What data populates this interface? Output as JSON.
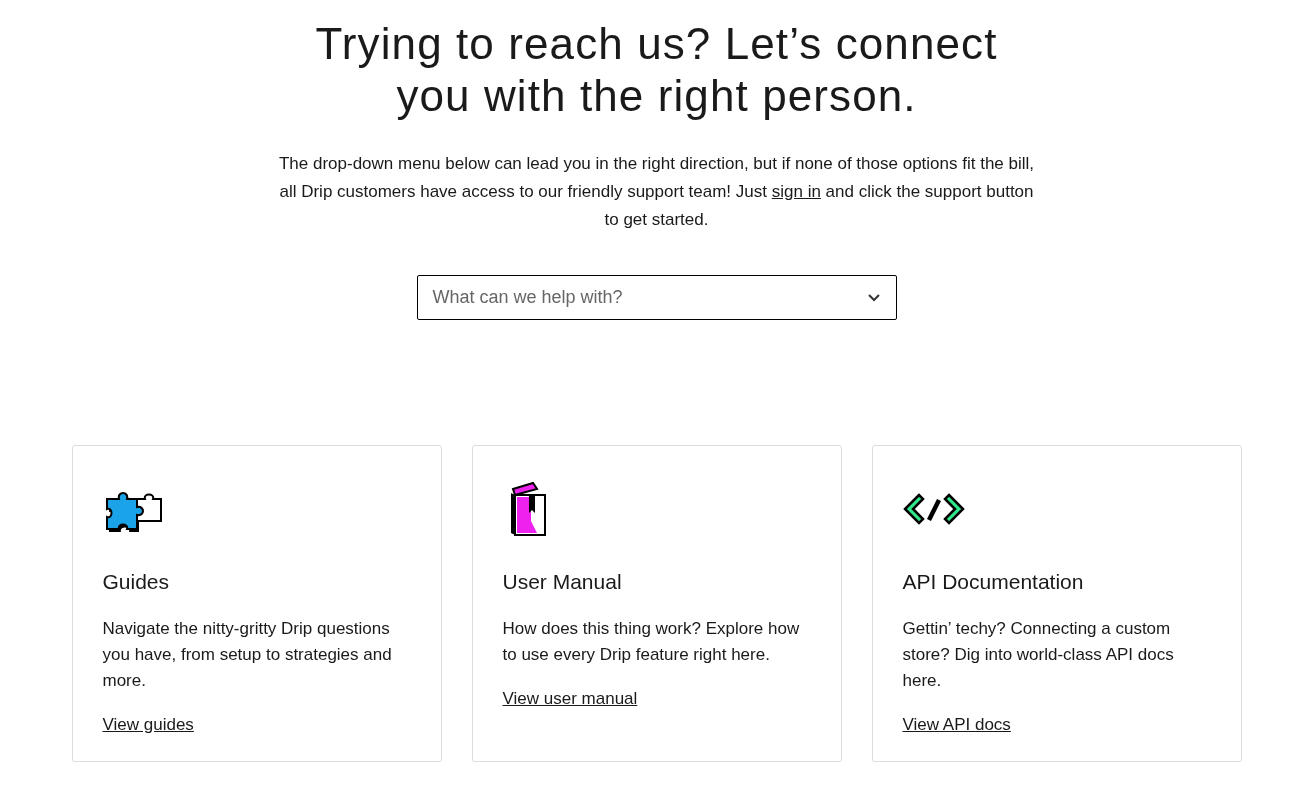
{
  "heading": "Trying to reach us? Let’s connect you with the right person.",
  "intro": {
    "before": "The drop-down menu below can lead you in the right direction, but if none of those options fit the bill, all Drip customers have access to our friendly support team! Just",
    "link": "sign in",
    "after": "and click the support button to get started."
  },
  "dropdown": {
    "placeholder": "What can we help with?"
  },
  "cards": [
    {
      "kind": "puzzle",
      "title": "Guides",
      "text": "Navigate the nitty-gritty Drip questions you have, from setup to strategies and more.",
      "link": "View guides"
    },
    {
      "kind": "book",
      "title": "User Manual",
      "text": "How does this thing work? Explore how to use every Drip feature right here.",
      "link": "View user manual"
    },
    {
      "kind": "code",
      "title": "API Documentation",
      "text": "Gettin’ techy? Connecting a custom store? Dig into world-class API docs here.",
      "link": "View API docs"
    }
  ]
}
